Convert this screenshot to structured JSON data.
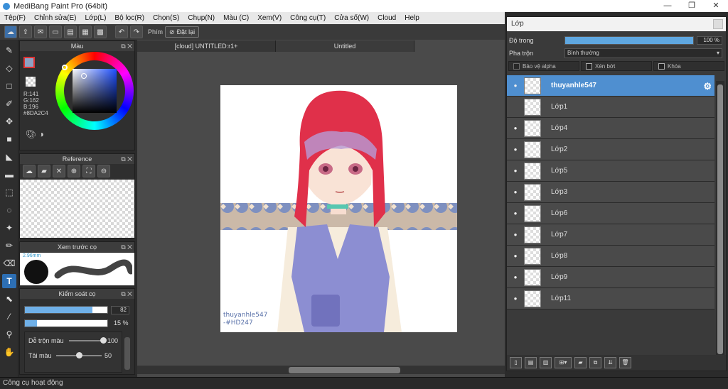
{
  "window": {
    "title": "MediBang Paint Pro (64bit)",
    "minimize": "—",
    "restore": "❐",
    "close": "✕"
  },
  "menu": [
    "Tệp(F)",
    "Chỉnh sửa(E)",
    "Lớp(L)",
    "Bộ lọc(R)",
    "Chọn(S)",
    "Chụp(N)",
    "Màu (C)",
    "Xem(V)",
    "Công cụ(T)",
    "Cửa số(W)",
    "Cloud",
    "Help"
  ],
  "toolbar": {
    "phim_label": "Phím",
    "reset_label": "Đặt lại"
  },
  "color_panel": {
    "title": "Màu",
    "rgb": "R:141\nG:162\nB:196",
    "hex": "#8DA2C4"
  },
  "reference_panel": {
    "title": "Reference"
  },
  "brush_preview_panel": {
    "title": "Xem trước cọ",
    "size": "2.96mm"
  },
  "brush_control_panel": {
    "title": "Kiểm soát cọ",
    "size_value": "82",
    "size_fraction": 0.82,
    "opacity_value": "15 %",
    "opacity_fraction": 0.15,
    "blend_label": "Dễ trộn màu",
    "blend_value": "100",
    "blend_fraction": 1.0,
    "reload_label": "Tải màu",
    "reload_value": "50",
    "reload_fraction": 0.5
  },
  "tabs": [
    "[cloud] UNTITLED:r1+",
    "Untitled"
  ],
  "artwork": {
    "signature_line1": "thuyanhle547",
    "signature_line2": "-#HD247"
  },
  "layer_panel": {
    "title": "Lớp",
    "opacity_label": "Độ trong",
    "opacity_value": "100 %",
    "opacity_fraction": 1.0,
    "blend_label": "Pha trộn",
    "blend_value": "Bình thường",
    "protect_alpha": "Bảo vệ alpha",
    "clipping": "Xén bớt",
    "lock": "Khóa",
    "layers": [
      {
        "name": "thuyanhle547",
        "visible": true,
        "active": true
      },
      {
        "name": "Lớp1",
        "visible": false,
        "active": false
      },
      {
        "name": "Lớp4",
        "visible": true,
        "active": false
      },
      {
        "name": "Lớp2",
        "visible": true,
        "active": false
      },
      {
        "name": "Lớp5",
        "visible": true,
        "active": false
      },
      {
        "name": "Lớp3",
        "visible": true,
        "active": false
      },
      {
        "name": "Lớp6",
        "visible": true,
        "active": false
      },
      {
        "name": "Lớp7",
        "visible": true,
        "active": false
      },
      {
        "name": "Lớp8",
        "visible": true,
        "active": false
      },
      {
        "name": "Lớp9",
        "visible": true,
        "active": false
      },
      {
        "name": "Lớp11",
        "visible": true,
        "active": false
      }
    ]
  },
  "status": "Công cụ hoạt động",
  "colors": {
    "accent": "#4f8fd0",
    "hair": "#e0304a",
    "vest": "#8d8fd0"
  }
}
